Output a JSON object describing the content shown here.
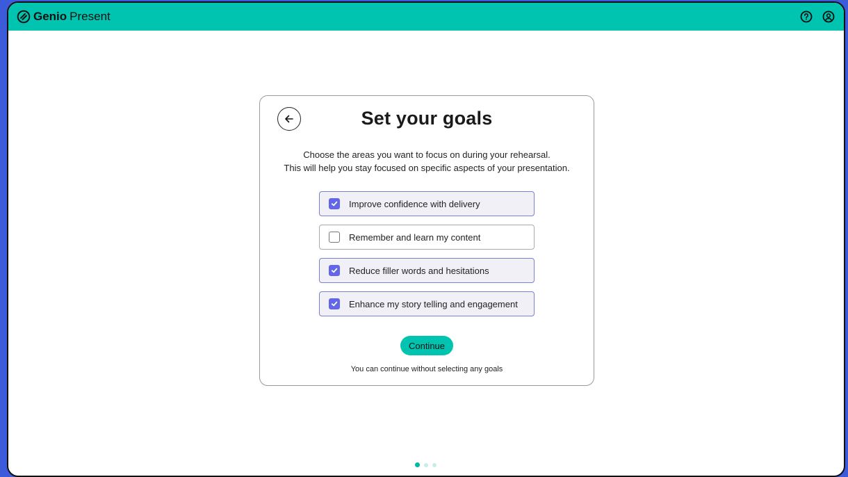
{
  "app": {
    "brand_bold": "Genio",
    "brand_light": "Present"
  },
  "header": {
    "icons": [
      "help-icon",
      "account-icon"
    ]
  },
  "card": {
    "title": "Set your goals",
    "description_line1": "Choose the areas you want to focus on during your rehearsal.",
    "description_line2": "This will help you stay focused on specific aspects of your presentation.",
    "goals": [
      {
        "label": "Improve confidence with delivery",
        "checked": true
      },
      {
        "label": "Remember and learn my content",
        "checked": false
      },
      {
        "label": "Reduce filler words and hesitations",
        "checked": true
      },
      {
        "label": "Enhance my story telling and engagement",
        "checked": true
      }
    ],
    "continue_label": "Continue",
    "hint": "You can continue without selecting any goals"
  },
  "pagination": {
    "total": 3,
    "current": 1
  },
  "colors": {
    "accent": "#00c4b0",
    "checkbox": "#6366e8",
    "checked_bg": "#f1f0f6"
  }
}
